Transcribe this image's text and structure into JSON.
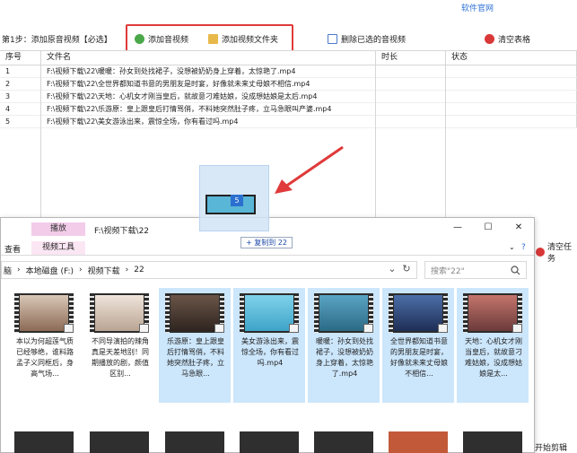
{
  "app": {
    "site_link": "软件官网",
    "step_label": "第1步：添加原音视频【必选】",
    "buttons": {
      "add_video": "添加音视频",
      "add_folder": "添加视频文件夹",
      "delete_selected": "删除已选的音视频",
      "clear_table": "清空表格"
    },
    "table": {
      "headers": [
        "序号",
        "文件名",
        "时长",
        "状态"
      ],
      "rows": [
        [
          "1",
          "F:\\视频下载\\22\\暖暖：孙女到处找裙子，没想被奶奶身上穿着，太惊艳了.mp4",
          "",
          ""
        ],
        [
          "2",
          "F:\\视频下载\\22\\全世界都知道书意的男朋友是时宴，好像就未来丈母娘不相信.mp4",
          "",
          ""
        ],
        [
          "3",
          "F:\\视频下载\\22\\天地：心机女才刚当皇后，就故意刁难姑娘，没成想姑娘是太后.mp4",
          "",
          ""
        ],
        [
          "4",
          "F:\\视频下载\\22\\乐游原：皇上跟皇后打情骂俏，不料她突然肚子疼，立马急眼叫产婆.mp4",
          "",
          ""
        ],
        [
          "5",
          "F:\\视频下载\\22\\美女游泳出来，震惊全场，你有看过吗.mp4",
          "",
          ""
        ]
      ]
    },
    "side": {
      "clear_task": "清空任务",
      "start_edit": "开始剪辑"
    },
    "colors": {
      "accent": "#2e6fd8",
      "highlight": "#e03a3a",
      "selection": "#cce6fb",
      "play_tab": "#f3cce9"
    }
  },
  "drag": {
    "count": "5",
    "tip": "+ 复制到 22"
  },
  "explorer": {
    "play_tab": "播放",
    "video_tools_tab": "视频工具",
    "view_tab": "查看",
    "title_path": "F:\\视频下载\\22",
    "breadcrumb": [
      "脑",
      "本地磁盘 (F:)",
      "视频下载",
      "22"
    ],
    "search_placeholder": "搜索\"22\"",
    "files": [
      {
        "caption": "本以为何超莲气质已经够绝，谁料路孟子义同框后，身高气场...",
        "selected": false
      },
      {
        "caption": "不同导演拍的辣角真是天差地别！同期播放的剧，颜值区别...",
        "selected": false
      },
      {
        "caption": "乐游原：皇上跟皇后打情骂俏，不料她突然肚子疼，立马急眼...",
        "selected": true
      },
      {
        "caption": "美女游泳出来，震惊全场，你有看过吗.mp4",
        "selected": true
      },
      {
        "caption": "暖暖：孙女到处找裙子，没想被奶奶身上穿着，太惊艳了.mp4",
        "selected": true
      },
      {
        "caption": "全世界都知道书意的男朋友是时宴，好像就未来丈母娘不相信...",
        "selected": true
      },
      {
        "caption": "天地：心机女才刚当皇后，就故意刁难姑娘，没成想姑娘是太...",
        "selected": true
      }
    ]
  }
}
